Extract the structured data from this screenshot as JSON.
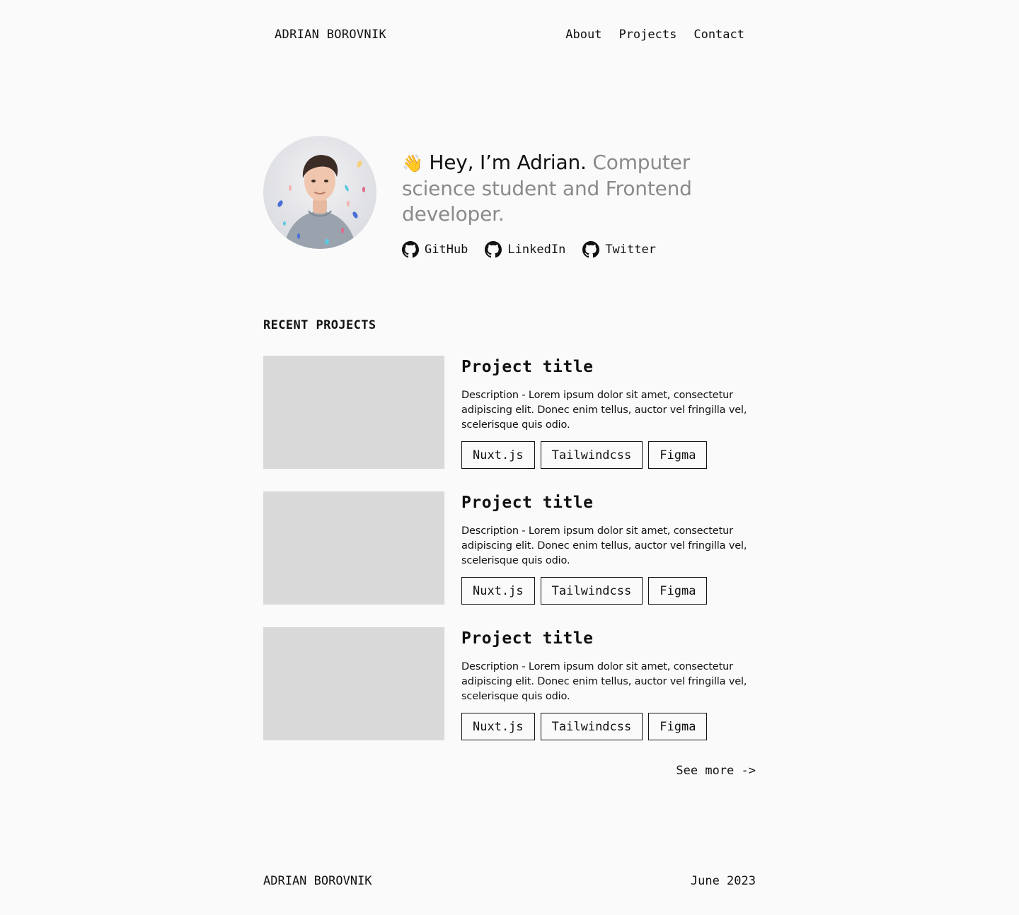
{
  "header": {
    "brand": "ADRIAN BOROVNIK",
    "nav": [
      {
        "label": "About"
      },
      {
        "label": "Projects"
      },
      {
        "label": "Contact"
      }
    ]
  },
  "hero": {
    "wave_emoji": "👋",
    "greeting": "Hey, I’m Adrian.",
    "tagline": "Computer science student and Frontend developer.",
    "socials": [
      {
        "label": "GitHub",
        "icon": "github-icon"
      },
      {
        "label": "LinkedIn",
        "icon": "github-icon"
      },
      {
        "label": "Twitter",
        "icon": "github-icon"
      }
    ]
  },
  "projects": {
    "section_title": "RECENT PROJECTS",
    "items": [
      {
        "title": "Project title",
        "description": "Description - Lorem ipsum dolor sit amet, consectetur adipiscing elit. Donec enim tellus, auctor vel fringilla vel, scelerisque quis odio.",
        "tags": [
          "Nuxt.js",
          "Tailwindcss",
          "Figma"
        ]
      },
      {
        "title": "Project title",
        "description": "Description - Lorem ipsum dolor sit amet, consectetur adipiscing elit. Donec enim tellus, auctor vel fringilla vel, scelerisque quis odio.",
        "tags": [
          "Nuxt.js",
          "Tailwindcss",
          "Figma"
        ]
      },
      {
        "title": "Project title",
        "description": "Description - Lorem ipsum dolor sit amet, consectetur adipiscing elit. Donec enim tellus, auctor vel fringilla vel, scelerisque quis odio.",
        "tags": [
          "Nuxt.js",
          "Tailwindcss",
          "Figma"
        ]
      }
    ],
    "see_more": "See more ->"
  },
  "footer": {
    "name": "ADRIAN BOROVNIK",
    "date": "June 2023"
  },
  "colors": {
    "background": "#fafafa",
    "text": "#111111",
    "muted_text": "#8a8a8a",
    "placeholder": "#d9d9d9"
  }
}
